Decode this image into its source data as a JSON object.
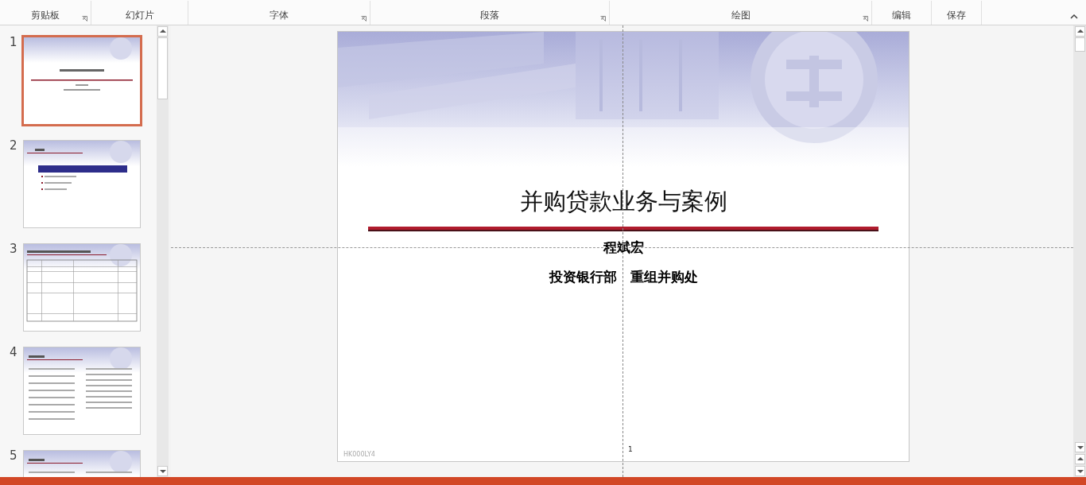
{
  "ribbon": {
    "groups": [
      {
        "label": "剪贴板",
        "launcher": true
      },
      {
        "label": "幻灯片",
        "launcher": false
      },
      {
        "label": "字体",
        "launcher": true
      },
      {
        "label": "段落",
        "launcher": true
      },
      {
        "label": "绘图",
        "launcher": true
      },
      {
        "label": "编辑",
        "launcher": false
      },
      {
        "label": "保存",
        "launcher": false
      }
    ]
  },
  "slides_panel": {
    "thumbnails": [
      {
        "number": "1",
        "kind": "title",
        "selected": true
      },
      {
        "number": "2",
        "kind": "agenda",
        "selected": false
      },
      {
        "number": "3",
        "kind": "table",
        "selected": false
      },
      {
        "number": "4",
        "kind": "bullets",
        "selected": false
      },
      {
        "number": "5",
        "kind": "bullets",
        "selected": false
      }
    ]
  },
  "slide": {
    "title": "并购贷款业务与案例",
    "author": "程斌宏",
    "department": "投资银行部　重组并购处",
    "footer": "HK000LY4",
    "page_number": "1"
  }
}
